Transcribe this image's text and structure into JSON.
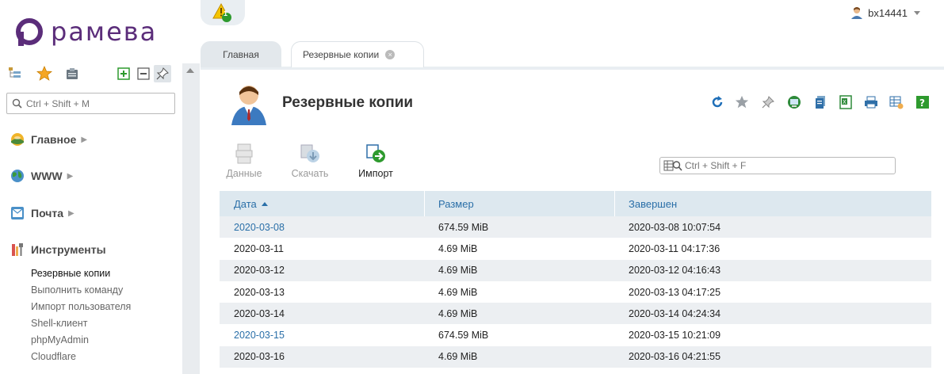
{
  "brand": {
    "logo_text": "рамева",
    "logo_color": "#5b2d7a"
  },
  "topbar": {
    "alert_count": "1",
    "username": "bx14441"
  },
  "sidebar": {
    "search_placeholder": "Ctrl + Shift + M",
    "toolbar_icons": [
      "tree-view-icon",
      "star-icon",
      "clipboard-icon",
      "expand-icon",
      "collapse-icon",
      "pin-icon"
    ],
    "groups": [
      {
        "label": "Главное",
        "icon": "home-globe-icon"
      },
      {
        "label": "WWW",
        "icon": "globe-icon"
      },
      {
        "label": "Почта",
        "icon": "mail-icon"
      },
      {
        "label": "Инструменты",
        "icon": "tools-icon"
      }
    ],
    "tools_items": [
      {
        "label": "Резервные копии",
        "active": true
      },
      {
        "label": "Выполнить команду",
        "active": false
      },
      {
        "label": "Импорт пользователя",
        "active": false
      },
      {
        "label": "Shell-клиент",
        "active": false
      },
      {
        "label": "phpMyAdmin",
        "active": false
      },
      {
        "label": "Cloudflare",
        "active": false
      }
    ]
  },
  "tabs": [
    {
      "label": "Главная",
      "active": false
    },
    {
      "label": "Резервные копии",
      "active": true
    }
  ],
  "page": {
    "title": "Резервные копии",
    "right_tools": [
      "refresh-icon",
      "star-icon",
      "pin-icon",
      "monitor-icon",
      "copy-icon",
      "excel-icon",
      "print-icon",
      "table-settings-icon",
      "help-icon"
    ],
    "actions": [
      {
        "label": "Данные",
        "enabled": false,
        "icon": "data-icon"
      },
      {
        "label": "Скачать",
        "enabled": false,
        "icon": "download-icon"
      },
      {
        "label": "Импорт",
        "enabled": true,
        "icon": "import-icon"
      }
    ],
    "filter_placeholder": "Ctrl + Shift + F"
  },
  "table": {
    "columns": [
      "Дата",
      "Размер",
      "Завершен"
    ],
    "sort_column": "Дата",
    "rows": [
      {
        "date": "2020-03-08",
        "size": "674.59 MiB",
        "finished": "2020-03-08 10:07:54",
        "link": true
      },
      {
        "date": "2020-03-11",
        "size": "4.69 MiB",
        "finished": "2020-03-11 04:17:36",
        "link": false
      },
      {
        "date": "2020-03-12",
        "size": "4.69 MiB",
        "finished": "2020-03-12 04:16:43",
        "link": false
      },
      {
        "date": "2020-03-13",
        "size": "4.69 MiB",
        "finished": "2020-03-13 04:17:25",
        "link": false
      },
      {
        "date": "2020-03-14",
        "size": "4.69 MiB",
        "finished": "2020-03-14 04:24:34",
        "link": false
      },
      {
        "date": "2020-03-15",
        "size": "674.59 MiB",
        "finished": "2020-03-15 10:21:09",
        "link": true
      },
      {
        "date": "2020-03-16",
        "size": "4.69 MiB",
        "finished": "2020-03-16 04:21:55",
        "link": false
      }
    ]
  },
  "colors": {
    "link": "#2a6fa8",
    "header_bg": "#dde8ef",
    "row_alt": "#eceff2",
    "nav_bg": "#e9eef2"
  }
}
